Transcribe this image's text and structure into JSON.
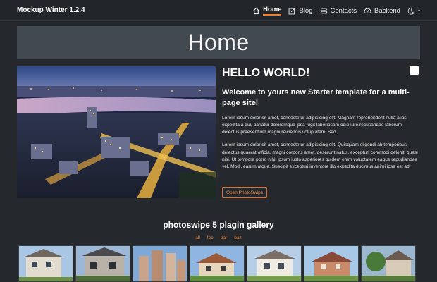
{
  "navbar": {
    "brand": "Mockup Winter 1.2.4",
    "items": [
      {
        "label": "Home",
        "icon": "home-icon"
      },
      {
        "label": "Blog",
        "icon": "edit-icon"
      },
      {
        "label": "Contacts",
        "icon": "signpost-icon"
      },
      {
        "label": "Backend",
        "icon": "speedometer-icon"
      }
    ],
    "theme_icon": "moon-icon"
  },
  "hero": {
    "title": "Home"
  },
  "main": {
    "heading": "HELLO WORLD!",
    "subheading": "Welcome to yours new Starter template for a multi-page site!",
    "paragraph1": "Lorem ipsum dolor sit amet, consectetur adipisicing elit. Magnam reprehenderit nulla alias expedita a qui, pariatur doloremque ipsa fugit laboriosam odio iure recusandae laborum delectus praesentium magni reiciendis voluptatem. Sed.",
    "paragraph2": "Lorem ipsum dolor sit amet, consectetur adipisicing elit. Quisquam eligendi ab temporibus delectus quaerat officia, magni corporis amet, deserunt natus, excepturi commodi deleniti quasi nisi. Ut tempora porro nihil ipsum iusto asperiores quidem enim voluptatem eaque repudiandae vel. Modi, earum atque. Suscipit excepturi inventore illo expedita ducimus animi ipsa est ad.",
    "button": "Open PhotoSwipe"
  },
  "gallery": {
    "title": "photoswipe 5 plagin gallery",
    "filters": [
      "all",
      "foo",
      "bar",
      "baz"
    ]
  },
  "colors": {
    "accent": "#f07d2a",
    "background": "#25282c",
    "hero_bg": "#424950"
  }
}
